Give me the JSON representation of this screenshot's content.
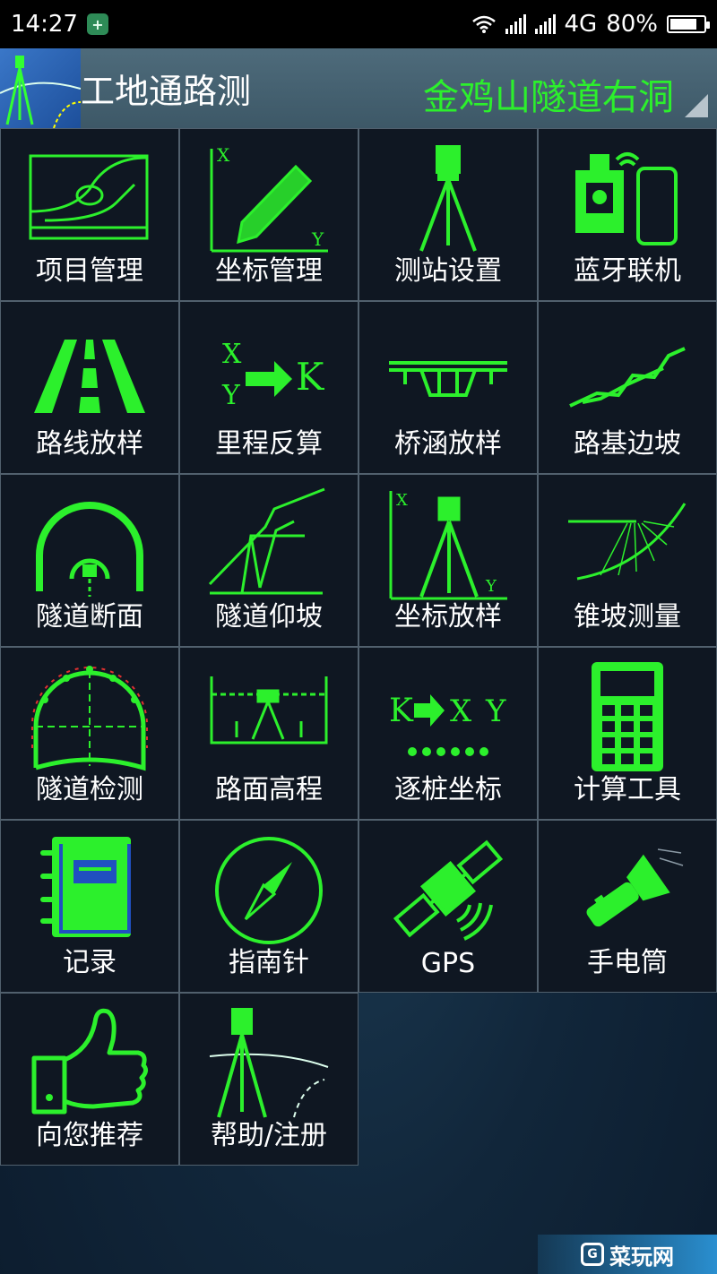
{
  "statusbar": {
    "time": "14:27",
    "network": "4G",
    "battery": "80%",
    "battery_level": 0.8
  },
  "header": {
    "title": "工地通路测",
    "project": "金鸡山隧道右洞"
  },
  "menu": [
    {
      "label": "项目管理",
      "icon": "project-chart-icon"
    },
    {
      "label": "坐标管理",
      "icon": "pencil-axes-icon"
    },
    {
      "label": "测站设置",
      "icon": "tripod-instrument-icon"
    },
    {
      "label": "蓝牙联机",
      "icon": "bluetooth-device-phone-icon"
    },
    {
      "label": "路线放样",
      "icon": "road-icon"
    },
    {
      "label": "里程反算",
      "icon": "xy-to-k-icon"
    },
    {
      "label": "桥涵放样",
      "icon": "bridge-icon"
    },
    {
      "label": "路基边坡",
      "icon": "slope-profile-icon"
    },
    {
      "label": "隧道断面",
      "icon": "tunnel-section-icon"
    },
    {
      "label": "隧道仰坡",
      "icon": "tunnel-slope-icon"
    },
    {
      "label": "坐标放样",
      "icon": "coordinate-stakeout-icon"
    },
    {
      "label": "锥坡测量",
      "icon": "cone-slope-icon"
    },
    {
      "label": "隧道检测",
      "icon": "tunnel-inspection-icon"
    },
    {
      "label": "路面高程",
      "icon": "road-elevation-icon"
    },
    {
      "label": "逐桩坐标",
      "icon": "k-to-xy-icon"
    },
    {
      "label": "计算工具",
      "icon": "calculator-icon"
    },
    {
      "label": "记录",
      "icon": "notebook-icon"
    },
    {
      "label": "指南针",
      "icon": "compass-icon"
    },
    {
      "label": "GPS",
      "icon": "satellite-icon"
    },
    {
      "label": "手电筒",
      "icon": "flashlight-icon"
    },
    {
      "label": "向您推荐",
      "icon": "thumbs-up-icon"
    },
    {
      "label": "帮助/注册",
      "icon": "help-tripod-icon"
    }
  ],
  "icon_text": {
    "x": "X",
    "y": "Y",
    "k": "K"
  },
  "watermark": "菜玩网",
  "colors": {
    "accent_green": "#2cf02c",
    "cell_bg": "#0f1722"
  }
}
